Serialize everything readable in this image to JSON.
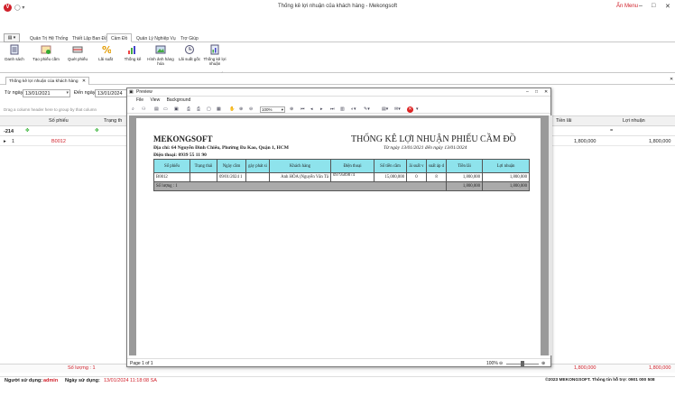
{
  "window": {
    "title": "Thống kê lợi nhuận của khách hàng - Mekongsoft",
    "hide_menu": "Ẩn Menu",
    "logo_letter": "V"
  },
  "menu_tabs": [
    "Quản Trị Hệ Thống",
    "Thiết Lập Ban Đầu",
    "Cầm Đồ",
    "Quản Lý Nghiệp Vụ",
    "Trợ Giúp"
  ],
  "ribbon": [
    "Danh sách",
    "Tạo phiếu cầm",
    "Quét phiếu",
    "Lãi suất",
    "Thống kê",
    "Hình ảnh hàng hóa",
    "Lãi suất gốc",
    "Thống kê lợi nhuận"
  ],
  "doc_tab": "Thống kê lợi nhuận của khách hàng",
  "filter": {
    "from_label": "Từ ngày",
    "from_value": "13/01/2021",
    "to_label": "Đến ngày",
    "to_value": "13/01/2024"
  },
  "grid": {
    "group_hint": "Drag a column header here to group by that column",
    "headers": {
      "so_phieu": "Số phiếu",
      "trang_thai": "Trạng th",
      "tien_lai": "Tiền lãi",
      "loi_nhuan": "Lợi nhuận"
    },
    "filter_value": "-214",
    "row": {
      "index": "1",
      "so_phieu": "B0012",
      "tien_lai": "1,800,000",
      "loi_nhuan": "1,800,000"
    },
    "footer": {
      "count": "Số lượng : 1",
      "tien_lai": "1,800,000",
      "loi_nhuan": "1,800,000"
    }
  },
  "status": {
    "user_label": "Người sử dụng:",
    "user": "admin",
    "date_label": "Ngày sử dụng:",
    "date": "13/01/2024 11:18:08 SA",
    "copyright": "©2023 MEKONGSOFT. Thông tin hỗ trợ: 0901 000 508"
  },
  "preview": {
    "title": "Preview",
    "menu": [
      "File",
      "View",
      "Background"
    ],
    "zoom": "100%",
    "page_info": "Page 1 of 1",
    "status_zoom": "100%",
    "report": {
      "company": "MEKONGSOFT",
      "address": "Địa chỉ: 64 Nguyễn Đình Chiểu, Phường Đa Kao, Quận 1, HCM",
      "phone": "Điện thoại: 0939 55 11 90",
      "title": "THỐNG KÊ LỢI NHUẬN PHIẾU CẦM ĐỒ",
      "subtitle": "Từ ngày 13/01/2021 đến ngày 13/01/2024",
      "columns": [
        "Số phiếu",
        "Trạng thái",
        "Ngày cầm",
        "gày phát si",
        "Khách hàng",
        "Điện thoại",
        "Số tiền cầm",
        "ãi suất v",
        "suất áp d",
        "Tiền lãi",
        "Lợi nhuận"
      ],
      "row": [
        "B0012",
        "",
        "09/01/2024 1",
        "",
        "Anh HÒA (Nguyễn Văn Tâ",
        "0979589874",
        "15,000,000",
        "0",
        "8",
        "1,800,000",
        "1,800,000"
      ],
      "sum": {
        "count": "Số lượng : 1",
        "tien_lai": "1,800,000",
        "loi_nhuan": "1,800,000"
      }
    }
  }
}
